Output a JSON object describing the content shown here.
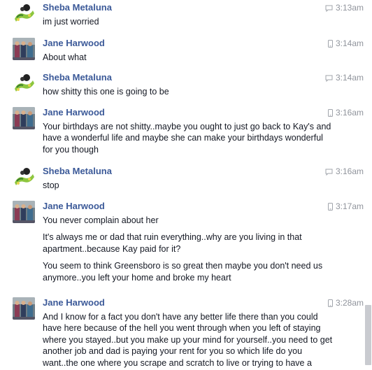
{
  "messages": [
    {
      "sender": "Sheba Metaluna",
      "time": "3:13am",
      "device": "web",
      "paragraphs": [
        "im just worried"
      ]
    },
    {
      "sender": "Jane Harwood",
      "time": "3:14am",
      "device": "mobile",
      "paragraphs": [
        "About what"
      ]
    },
    {
      "sender": "Sheba Metaluna",
      "time": "3:14am",
      "device": "web",
      "paragraphs": [
        "how shitty this one is going to be"
      ]
    },
    {
      "sender": "Jane Harwood",
      "time": "3:16am",
      "device": "mobile",
      "paragraphs": [
        "Your birthdays are not shitty..maybe you ought to just go back to Kay's and have a wonderful life and maybe she can make your birthdays wonderful for you though"
      ]
    },
    {
      "sender": "Sheba Metaluna",
      "time": "3:16am",
      "device": "web",
      "paragraphs": [
        "stop"
      ]
    },
    {
      "sender": "Jane Harwood",
      "time": "3:17am",
      "device": "mobile",
      "paragraphs": [
        "You never complain about her",
        "It's always me or dad that ruin everything..why are you living in that apartment..because Kay paid for it?",
        "You seem to think Greensboro is so great then maybe you don't need us anymore..you left your home and broke my heart"
      ]
    },
    {
      "sender": "Jane Harwood",
      "time": "3:28am",
      "device": "mobile",
      "paragraphs": [
        "And I know for a fact you don't have any better life there than you could have here because of the hell you went through when you left of staying where you stayed..but you make up your mind for yourself..you need to get another job and dad is paying your rent for you so which life do you want..the one where you scrape and scratch to live or trying to have a"
      ]
    }
  ],
  "icons": {
    "web": "chat-bubble-icon",
    "mobile": "mobile-phone-icon"
  },
  "colors": {
    "sender": "#3b5998",
    "timestamp": "#90949c",
    "text": "#141823"
  }
}
